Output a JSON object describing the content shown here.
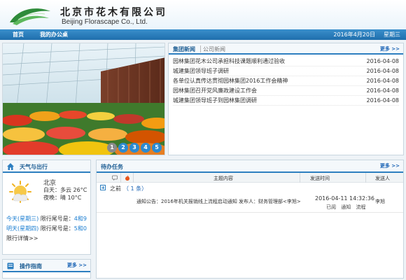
{
  "header": {
    "brand_cn": "北京市花木有限公司",
    "brand_en": "Beijing Florascape Co., Ltd.",
    "logo_icon": "leaf-logo-icon",
    "accent": "#2e8b3a"
  },
  "nav": {
    "items": [
      "首页",
      "我的办公桌"
    ],
    "date": "2016年4月20日",
    "weekday": "星期三",
    "color": "#2672b4"
  },
  "banner": {
    "slides": [
      "1",
      "2",
      "3",
      "4",
      "5"
    ],
    "active_slide": "1"
  },
  "news": {
    "tabs": [
      "集团新闻",
      "公司新闻"
    ],
    "more": "更多 >>",
    "items": [
      {
        "title": "园林集团花木公司承担科技课题顺利通过验收",
        "date": "2016-04-08"
      },
      {
        "title": "城建集团领导班子调研",
        "date": "2016-04-08"
      },
      {
        "title": "各单位认真传达贯彻园林集团2016工作会精神",
        "date": "2016-04-08"
      },
      {
        "title": "园林集团召开党风廉政建设工作会",
        "date": "2016-04-08"
      },
      {
        "title": "城建集团领导班子到园林集团调研",
        "date": "2016-04-08"
      }
    ]
  },
  "weather": {
    "title": "天气与出行",
    "icon": "sun-icon",
    "city": "北京",
    "day": "白天：多云  26°C",
    "night": "夜晚：晴  10°C",
    "limits": [
      {
        "day": "今天(星期三)",
        "label": " 限行尾号是：",
        "num": "4和9"
      },
      {
        "day": "明天(星期四)",
        "label": " 限行尾号是：",
        "num": "5和0"
      }
    ],
    "more": "限行详情>>"
  },
  "guide": {
    "title": "操作指南",
    "more": "更多 >>"
  },
  "tasks": {
    "title": "待办任务",
    "more": "更多 >>",
    "columns": {
      "subject": "主题内容",
      "time": "发送时间",
      "sender": "发送人"
    },
    "group": {
      "label": "之前",
      "count": "（ 1 条）"
    },
    "rows": [
      {
        "subject": "通知公告：2016年机关报销线上流程启动通知 发布人：财务管理部<李旭>",
        "time": "2016-04-11 14:32:36",
        "actions": [
          "已阅",
          "通知",
          "流程"
        ],
        "sender": "李旭"
      }
    ]
  }
}
